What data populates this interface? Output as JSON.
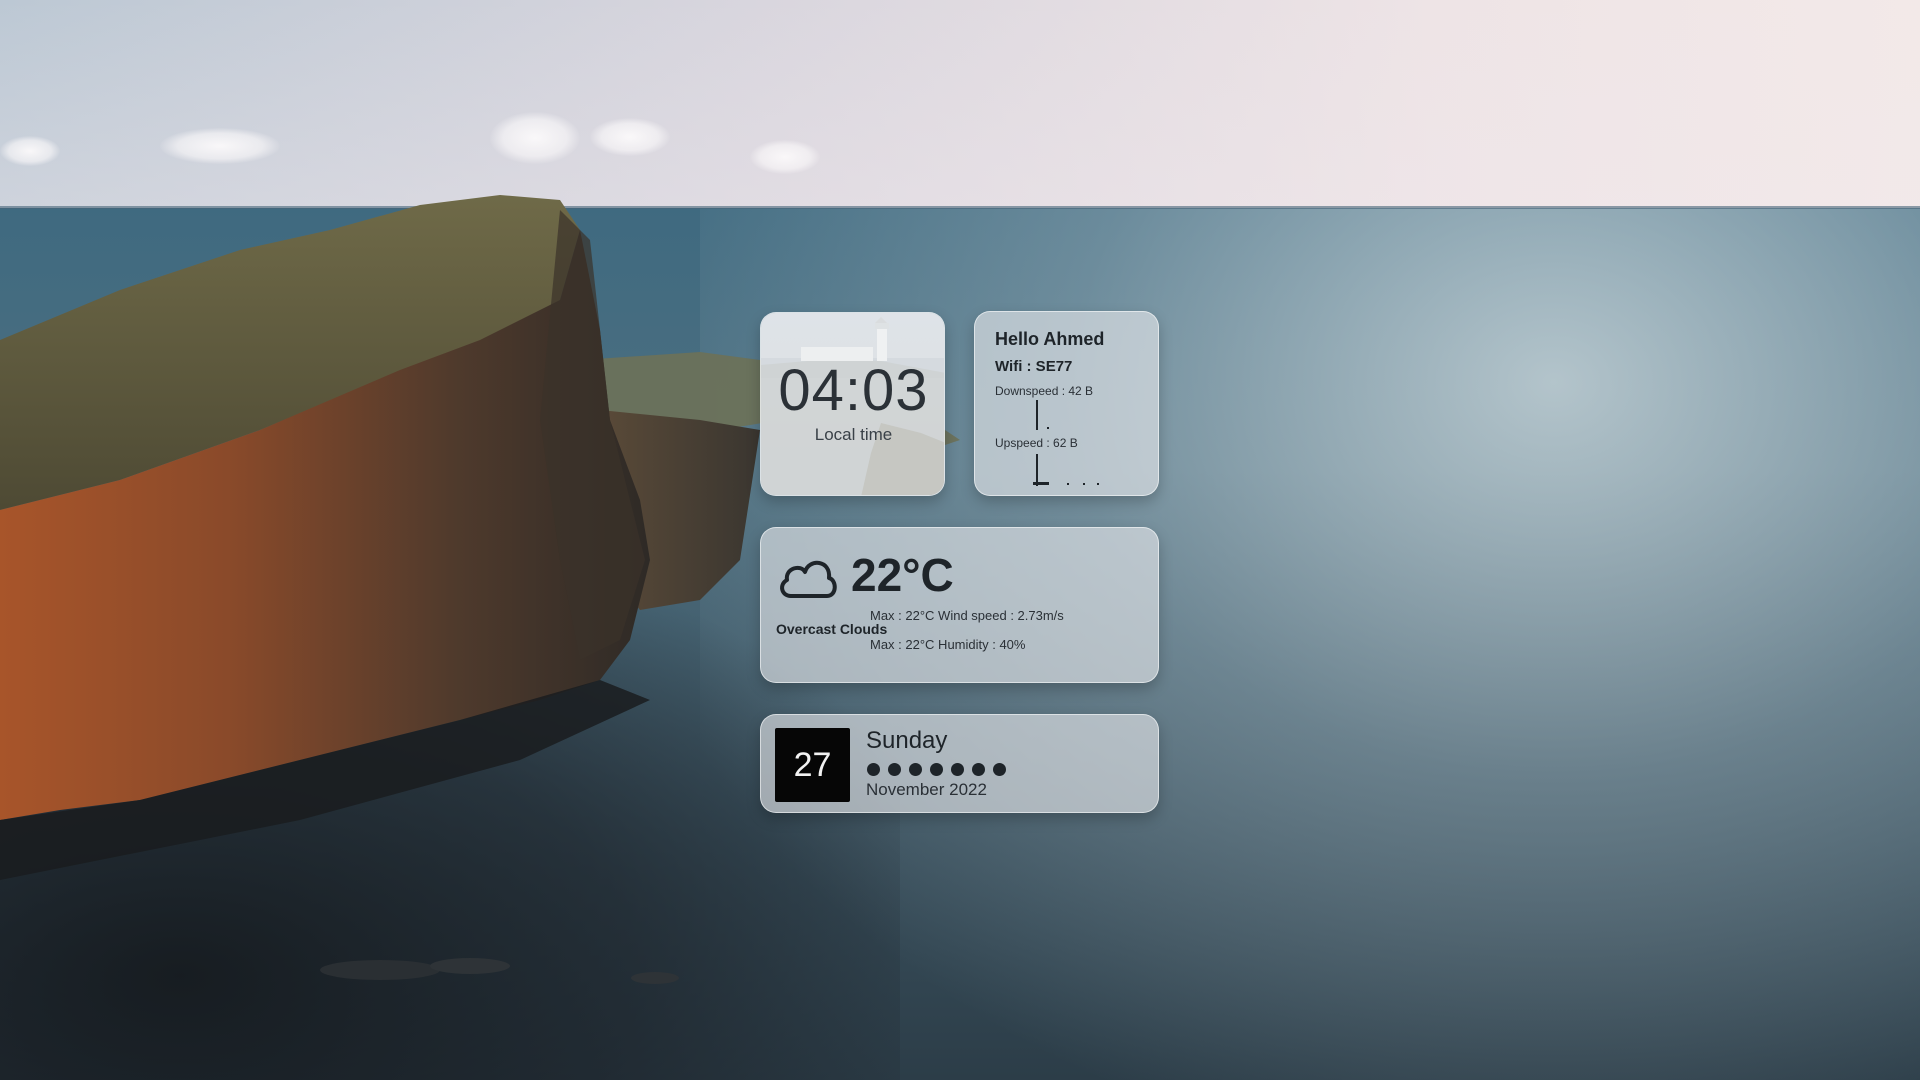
{
  "clock": {
    "time": "04:03",
    "label": "Local time"
  },
  "network": {
    "greeting": "Hello Ahmed",
    "wifi": "Wifi :  SE77",
    "downspeed": "Downspeed : 42 B",
    "upspeed": "Upspeed : 62 B"
  },
  "weather": {
    "icon": "cloud-icon",
    "temperature": "22°C",
    "description": "Overcast Clouds",
    "line1": "Max : 22°C Wind speed : 2.73m/s",
    "line2": "Max : 22°C Humidity : 40%"
  },
  "date": {
    "day": "27",
    "weekday": "Sunday",
    "month_year": "November 2022",
    "dot_count": 7
  },
  "colors": {
    "widget_bg": "#e6e9ec",
    "text": "#1e2429",
    "day_box": "#060606"
  }
}
